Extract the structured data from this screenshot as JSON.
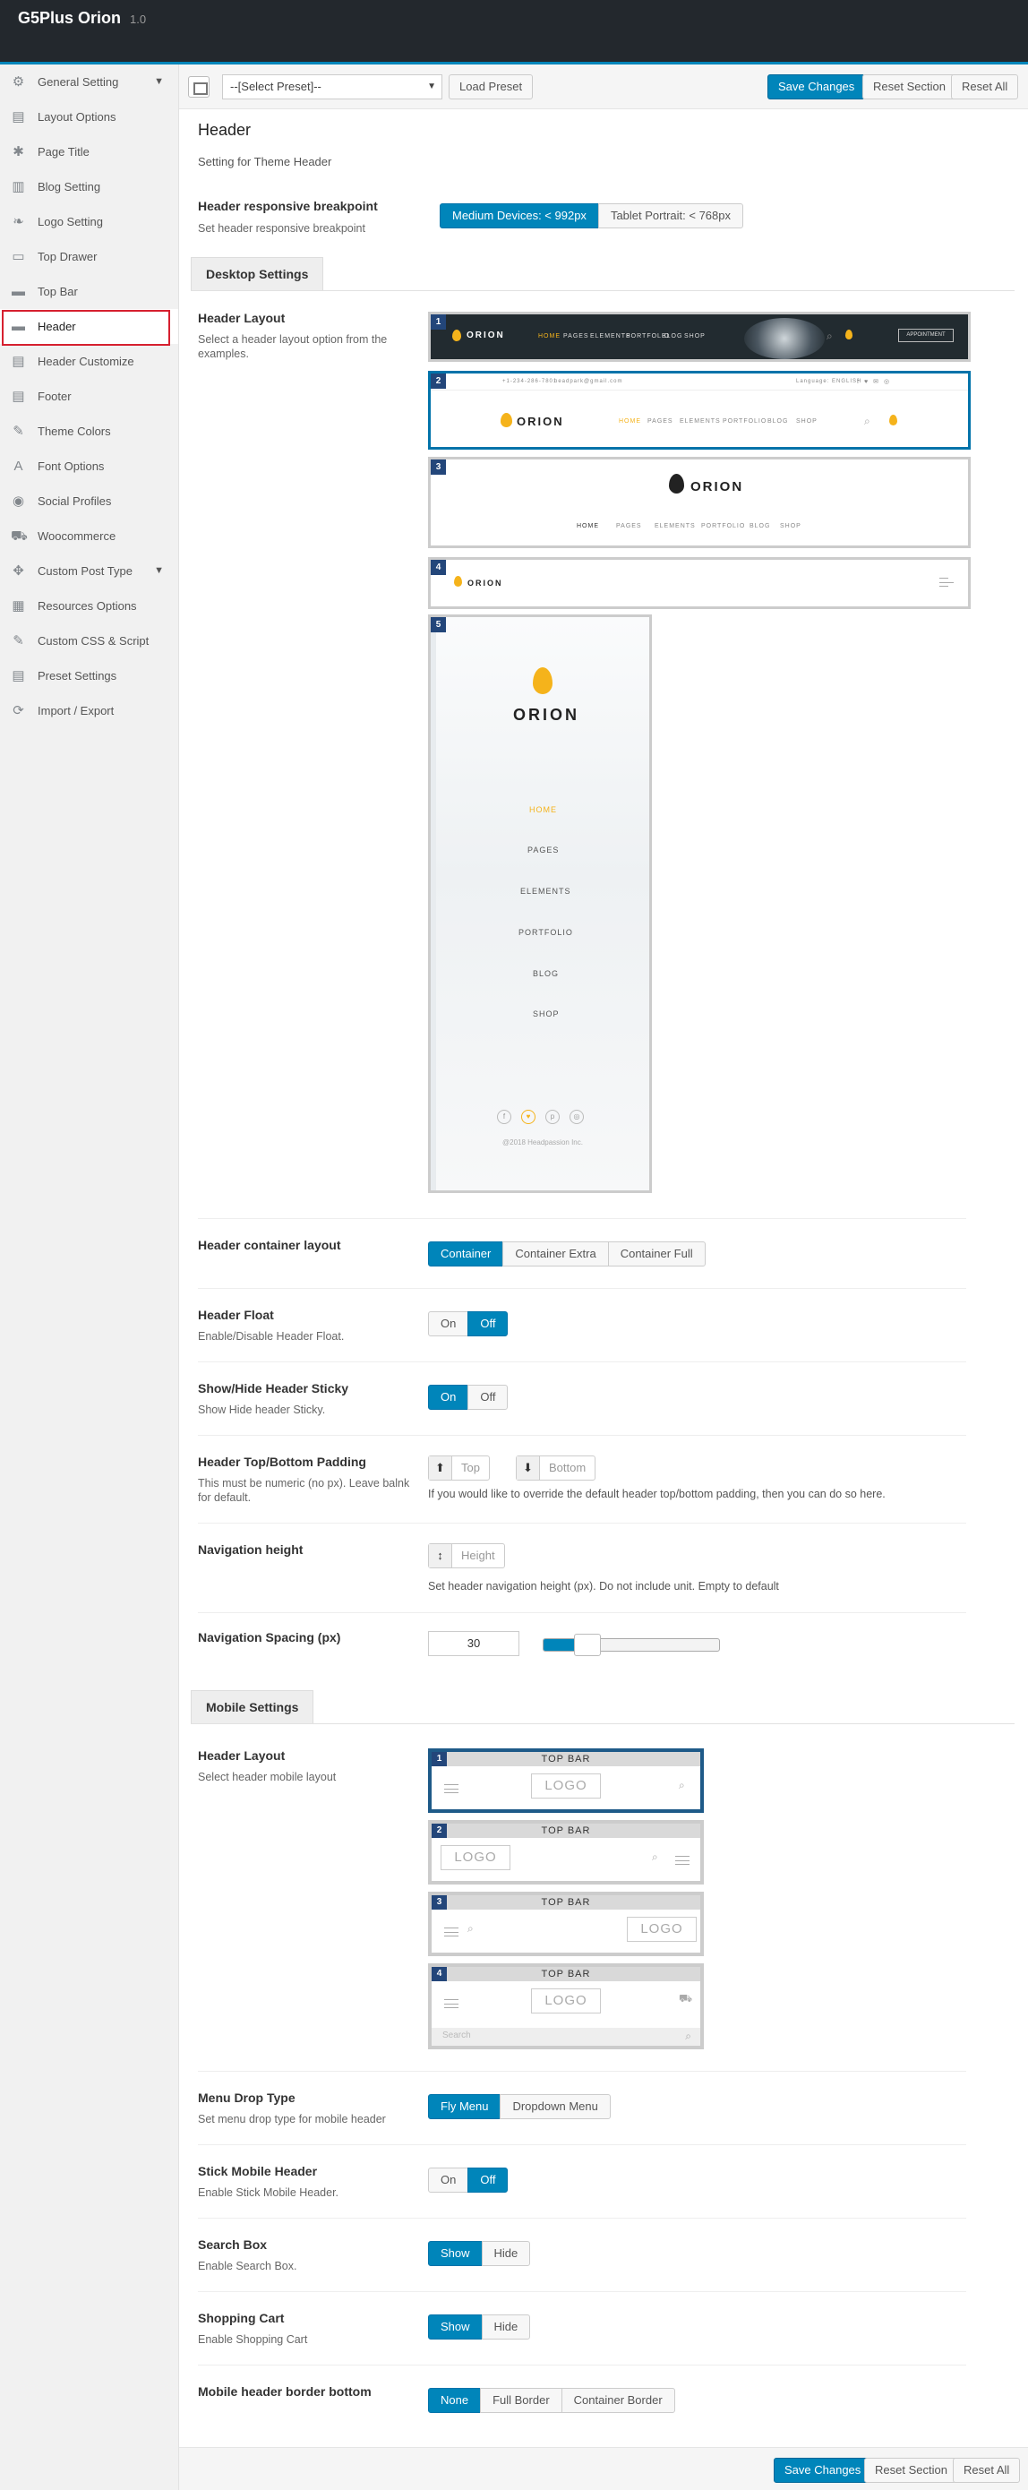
{
  "app": {
    "title": "G5Plus Orion",
    "version": "1.0"
  },
  "sidebar": {
    "items": [
      {
        "label": "General Setting",
        "icon": "gear-icon",
        "glyph": "⚙",
        "chevron": true
      },
      {
        "label": "Layout Options",
        "icon": "layout-icon",
        "glyph": "▤"
      },
      {
        "label": "Page Title",
        "icon": "pin-icon",
        "glyph": "✱"
      },
      {
        "label": "Blog Setting",
        "icon": "blog-icon",
        "glyph": "▥"
      },
      {
        "label": "Logo Setting",
        "icon": "leaf-icon",
        "glyph": "❧"
      },
      {
        "label": "Top Drawer",
        "icon": "drawer-icon",
        "glyph": "▭"
      },
      {
        "label": "Top Bar",
        "icon": "bar-icon",
        "glyph": "▬"
      },
      {
        "label": "Header",
        "icon": "header-icon",
        "glyph": "▬",
        "active": true
      },
      {
        "label": "Header Customize",
        "icon": "header-customize-icon",
        "glyph": "▤"
      },
      {
        "label": "Footer",
        "icon": "footer-icon",
        "glyph": "▤"
      },
      {
        "label": "Theme Colors",
        "icon": "wand-icon",
        "glyph": "✎"
      },
      {
        "label": "Font Options",
        "icon": "font-icon",
        "glyph": "A"
      },
      {
        "label": "Social Profiles",
        "icon": "social-icon",
        "glyph": "◉"
      },
      {
        "label": "Woocommerce",
        "icon": "cart-icon",
        "glyph": "⛟"
      },
      {
        "label": "Custom Post Type",
        "icon": "puzzle-icon",
        "glyph": "✥",
        "chevron": true
      },
      {
        "label": "Resources Options",
        "icon": "grid-icon",
        "glyph": "▦"
      },
      {
        "label": "Custom CSS & Script",
        "icon": "code-icon",
        "glyph": "✎"
      },
      {
        "label": "Preset Settings",
        "icon": "preset-icon",
        "glyph": "▤"
      },
      {
        "label": "Import / Export",
        "icon": "sync-icon",
        "glyph": "⟳"
      }
    ]
  },
  "toolbar": {
    "preset_select": "--[Select Preset]--",
    "load_preset": "Load Preset",
    "save_changes": "Save Changes",
    "reset_section": "Reset Section",
    "reset_all": "Reset All"
  },
  "section": {
    "title": "Header",
    "desc": "Setting for Theme Header"
  },
  "breakpoint": {
    "label": "Header responsive breakpoint",
    "desc": "Set header responsive breakpoint",
    "options": [
      "Medium Devices: < 992px",
      "Tablet Portrait: < 768px"
    ]
  },
  "desktop": {
    "tab": "Desktop Settings",
    "layout_label": "Header Layout",
    "layout_desc": "Select a header layout option from the examples.",
    "logo": "ORION",
    "nav": [
      "HOME",
      "PAGES",
      "ELEMENTS",
      "PORTFOLIO",
      "BLOG",
      "SHOP"
    ],
    "appointment": "APPOINTMENT",
    "phone": "+1-234-286-7801",
    "email": "headpark@gmail.com",
    "language": "Language: ENGLISH",
    "copyright": "@2018 Headpassion Inc.",
    "layouts": [
      "1",
      "2",
      "3",
      "4",
      "5"
    ]
  },
  "container": {
    "label": "Header container layout",
    "options": [
      "Container",
      "Container Extra",
      "Container Full"
    ]
  },
  "float": {
    "label": "Header Float",
    "desc": "Enable/Disable Header Float.",
    "options": [
      "On",
      "Off"
    ]
  },
  "sticky": {
    "label": "Show/Hide Header Sticky",
    "desc": "Show Hide header Sticky.",
    "options": [
      "On",
      "Off"
    ]
  },
  "padding": {
    "label": "Header Top/Bottom Padding",
    "desc": "This must be numeric (no px). Leave balnk for default.",
    "top": "Top",
    "bottom": "Bottom",
    "hint": "If you would like to override the default header top/bottom padding, then you can do so here."
  },
  "navheight": {
    "label": "Navigation height",
    "placeholder": "Height",
    "hint": "Set header navigation height (px). Do not include unit. Empty to default"
  },
  "navspacing": {
    "label": "Navigation Spacing (px)",
    "value": "30",
    "fraction": 0.18
  },
  "mobile": {
    "tab": "Mobile Settings",
    "layout_label": "Header Layout",
    "layout_desc": "Select header mobile layout",
    "topbar": "TOP   BAR",
    "logo": "LOGO",
    "search": "Search",
    "layouts": [
      "1",
      "2",
      "3",
      "4"
    ]
  },
  "menudrop": {
    "label": "Menu Drop Type",
    "desc": "Set menu drop type for mobile header",
    "options": [
      "Fly Menu",
      "Dropdown Menu"
    ]
  },
  "stickmobile": {
    "label": "Stick Mobile Header",
    "desc": "Enable Stick Mobile Header.",
    "options": [
      "On",
      "Off"
    ]
  },
  "searchbox": {
    "label": "Search Box",
    "desc": "Enable Search Box.",
    "options": [
      "Show",
      "Hide"
    ]
  },
  "cart": {
    "label": "Shopping Cart",
    "desc": "Enable Shopping Cart",
    "options": [
      "Show",
      "Hide"
    ]
  },
  "border": {
    "label": "Mobile header border bottom",
    "options": [
      "None",
      "Full Border",
      "Container Border"
    ]
  },
  "colors": {
    "accent": "#0085ba",
    "highlight": "#d6202f",
    "logo_flame": "#f5b31b"
  }
}
